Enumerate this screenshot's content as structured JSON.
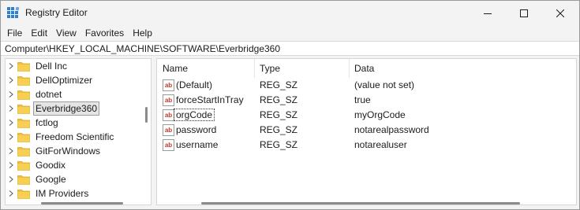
{
  "window": {
    "title": "Registry Editor"
  },
  "title_buttons": {
    "minimize": "minimize",
    "maximize": "maximize",
    "close": "close"
  },
  "menu": [
    "File",
    "Edit",
    "View",
    "Favorites",
    "Help"
  ],
  "address": "Computer\\HKEY_LOCAL_MACHINE\\SOFTWARE\\Everbridge360",
  "tree": {
    "items": [
      {
        "label": "Dell Inc",
        "selected": false
      },
      {
        "label": "DellOptimizer",
        "selected": false
      },
      {
        "label": "dotnet",
        "selected": false
      },
      {
        "label": "Everbridge360",
        "selected": true
      },
      {
        "label": "fctlog",
        "selected": false
      },
      {
        "label": "Freedom Scientific",
        "selected": false
      },
      {
        "label": "GitForWindows",
        "selected": false
      },
      {
        "label": "Goodix",
        "selected": false
      },
      {
        "label": "Google",
        "selected": false
      },
      {
        "label": "IM Providers",
        "selected": false
      }
    ]
  },
  "list": {
    "columns": [
      "Name",
      "Type",
      "Data"
    ],
    "rows": [
      {
        "name": "(Default)",
        "type": "REG_SZ",
        "data": "(value not set)"
      },
      {
        "name": "forceStartInTray",
        "type": "REG_SZ",
        "data": "true"
      },
      {
        "name": "orgCode",
        "type": "REG_SZ",
        "data": "myOrgCode"
      },
      {
        "name": "password",
        "type": "REG_SZ",
        "data": "notarealpassword"
      },
      {
        "name": "username",
        "type": "REG_SZ",
        "data": "notarealuser"
      }
    ]
  },
  "icons": {
    "app": "registry-editor-icon",
    "folder": "folder-icon",
    "value": "string-value-icon",
    "chevron": "chevron-right-icon"
  },
  "colors": {
    "folder": "#f2c03e",
    "value_icon_red": "#c0392b",
    "selected_bg": "#e5e5e5"
  }
}
